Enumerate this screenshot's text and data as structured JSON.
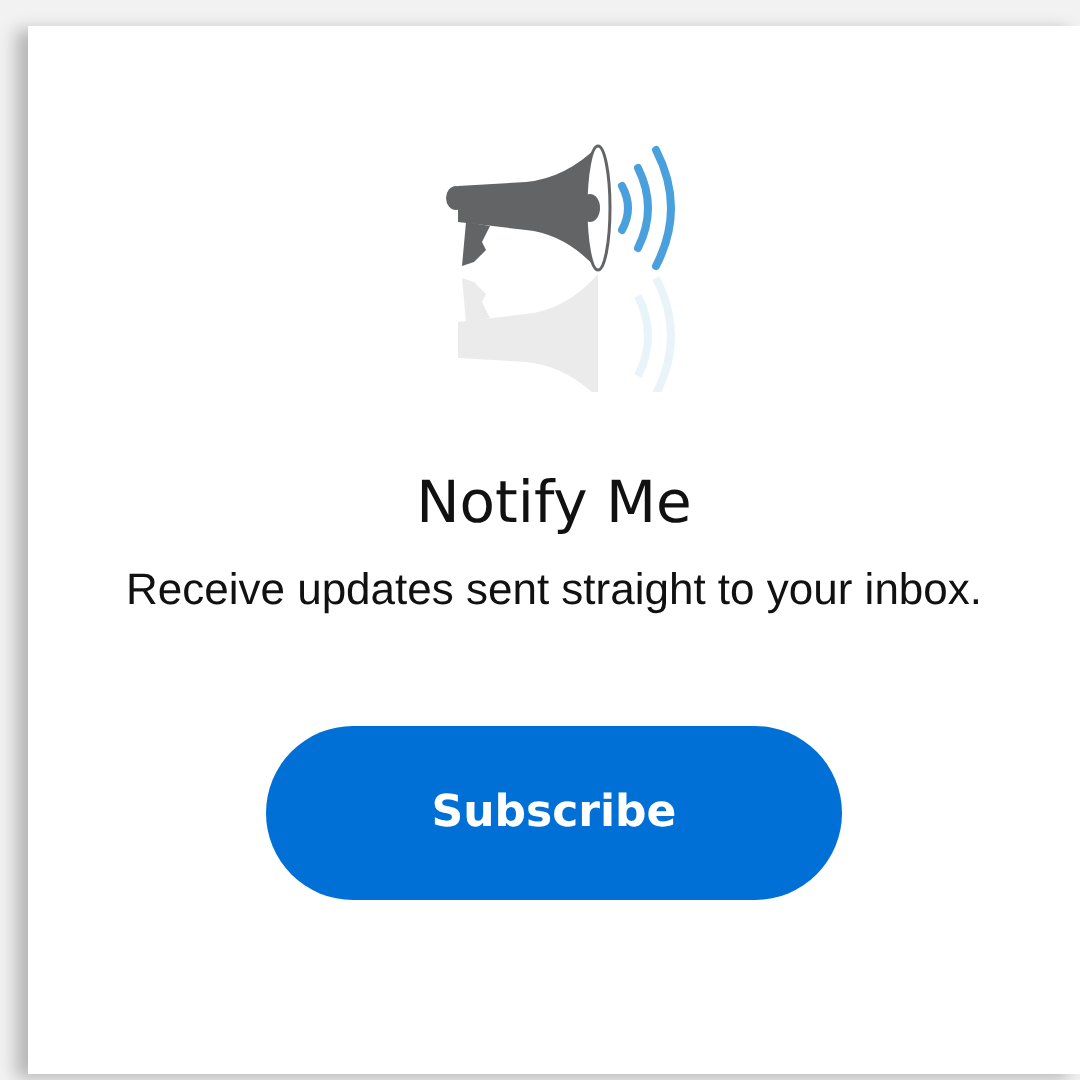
{
  "card": {
    "title": "Notify Me",
    "description": "Receive updates sent straight to your inbox.",
    "button": "Subscribe"
  }
}
